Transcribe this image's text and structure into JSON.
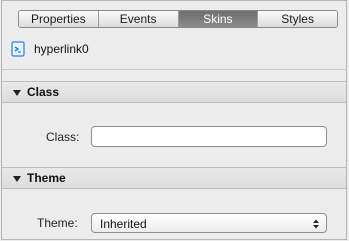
{
  "tabs": [
    {
      "label": "Properties",
      "active": false
    },
    {
      "label": "Events",
      "active": false
    },
    {
      "label": "Skins",
      "active": true
    },
    {
      "label": "Styles",
      "active": false
    }
  ],
  "component": {
    "name": "hyperlink0",
    "icon": "hyperlink-component-icon"
  },
  "class_section": {
    "title": "Class",
    "field_label": "Class:",
    "value": ""
  },
  "theme_section": {
    "title": "Theme",
    "field_label": "Theme:",
    "selected": "Inherited"
  },
  "colors": {
    "active_tab": "#7a7a7a",
    "panel_bg": "#ececec",
    "icon_blue": "#2a7fd4"
  }
}
